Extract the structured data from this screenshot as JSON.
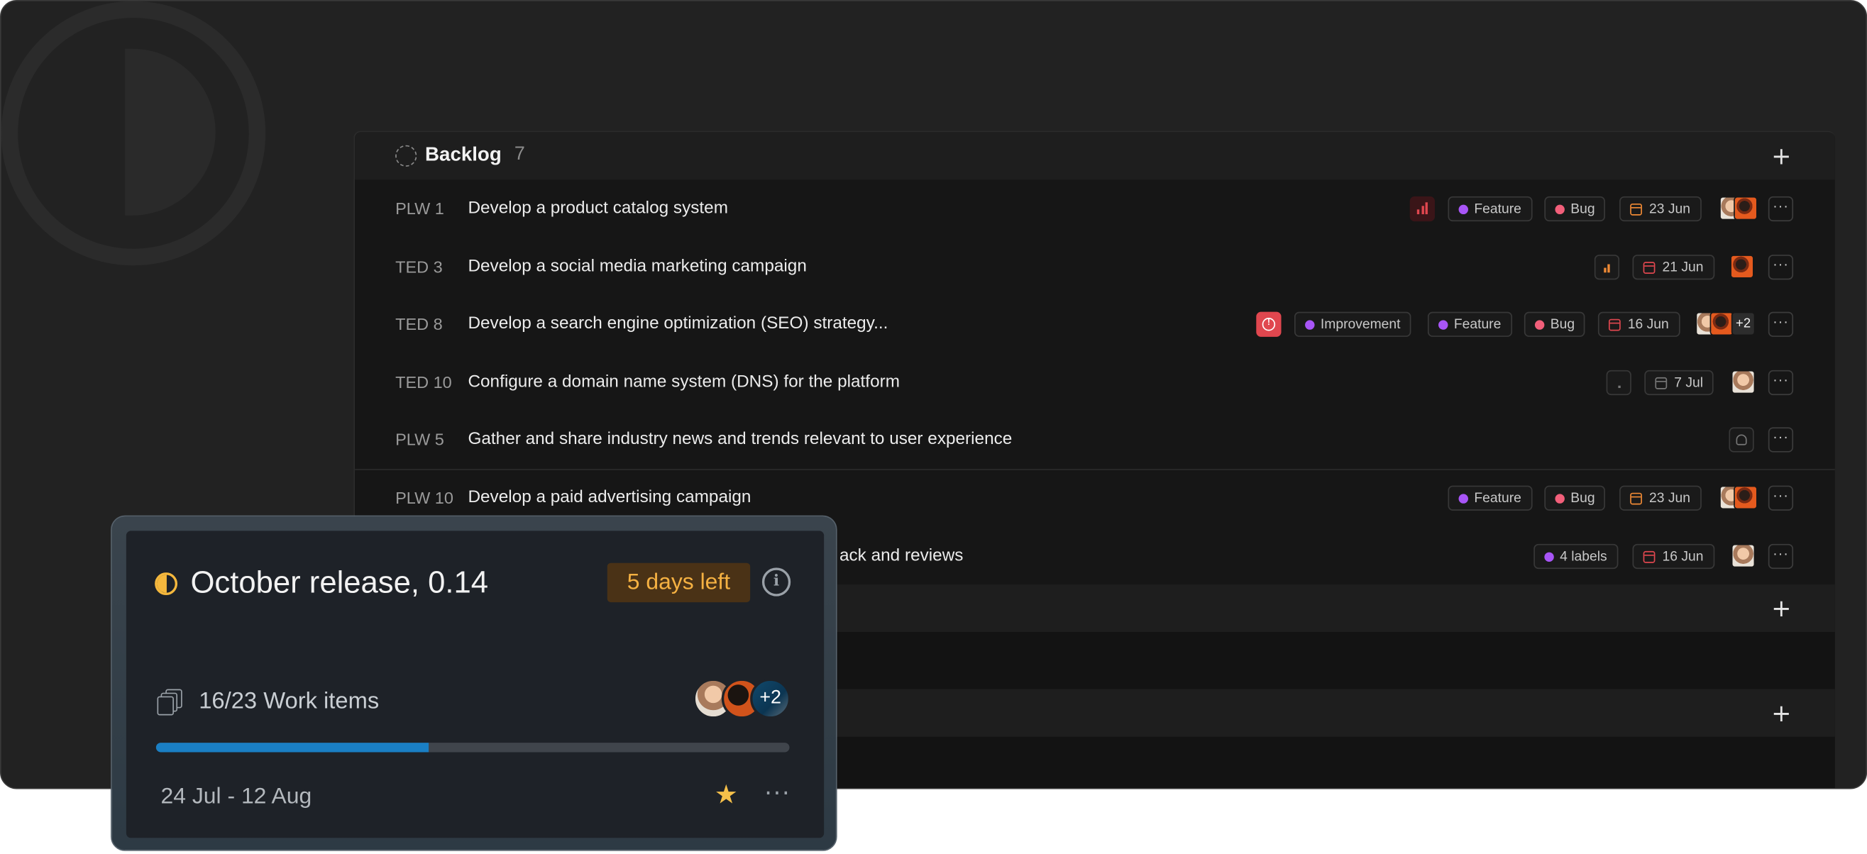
{
  "backlog": {
    "title": "Backlog",
    "count": "7",
    "add_icon": "plus-icon"
  },
  "rows": [
    {
      "id": "PLW 1",
      "title": "Develop a product catalog system",
      "priority": "high",
      "labels": [
        "Feature",
        "Bug"
      ],
      "date": "23 Jun"
    },
    {
      "id": "TED 3",
      "title": "Develop a social media marketing campaign",
      "priority": "medium",
      "labels": [],
      "date": "21 Jun"
    },
    {
      "id": "TED 8",
      "title": "Develop a search engine optimization (SEO) strategy...",
      "priority": "urgent",
      "labels": [
        "Improvement",
        "Feature",
        "Bug"
      ],
      "date": "16 Jun",
      "extra_assignees": "+2"
    },
    {
      "id": "TED 10",
      "title": "Configure a domain name system (DNS) for the platform",
      "priority": "none",
      "labels": [],
      "date": "7 Jul"
    },
    {
      "id": "PLW 5",
      "title": "Gather and share industry news and trends relevant to user experience",
      "priority": "none",
      "labels": [],
      "date": ""
    },
    {
      "id": "PLW 10",
      "title": "Develop a paid advertising campaign",
      "priority": "",
      "labels": [
        "Feature",
        "Bug"
      ],
      "date": "23 Jun"
    },
    {
      "id": "",
      "title": "ack and reviews",
      "priority": "",
      "labels": [
        "4 labels"
      ],
      "date": "16 Jun"
    }
  ],
  "colors": {
    "label_feature": "#a855f7",
    "label_bug": "#f25f7a",
    "priority_urgent": "#e0474f",
    "accent_cycle": "#f5b83d",
    "progress": "#1a7fc4"
  },
  "cycle_card": {
    "title": "October release, 0.14",
    "days_left": "5 days left",
    "work_items": "16/23 Work items",
    "progress": 0.43,
    "extra_members": "+2",
    "date_range": "24 Jul - 12 Aug",
    "favorite": true,
    "icons": [
      "cycle-half-icon",
      "info-icon",
      "stack-icon",
      "star-icon",
      "more-icon"
    ]
  }
}
